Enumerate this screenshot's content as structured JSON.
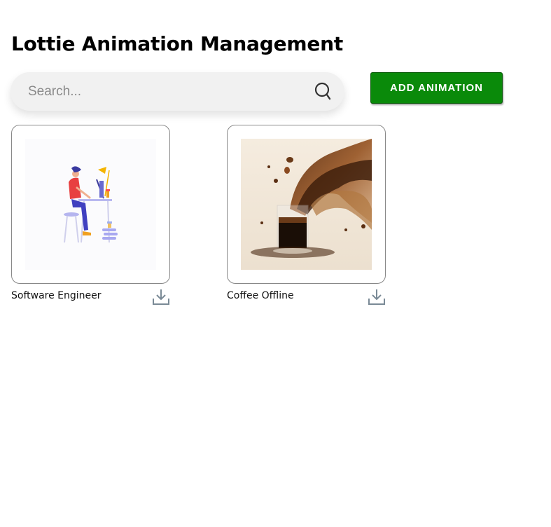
{
  "page": {
    "title": "Lottie Animation Management"
  },
  "search": {
    "placeholder": "Search...",
    "value": "",
    "icon": "search-icon"
  },
  "toolbar": {
    "add_label": "ADD ANIMATION",
    "add_color": "#0a8a0a"
  },
  "animations": [
    {
      "name": "Software Engineer",
      "thumbnail": "developer-at-desk-illustration",
      "action_icon": "download-icon"
    },
    {
      "name": "Coffee Offline",
      "thumbnail": "coffee-splash-photo",
      "action_icon": "download-icon"
    }
  ]
}
